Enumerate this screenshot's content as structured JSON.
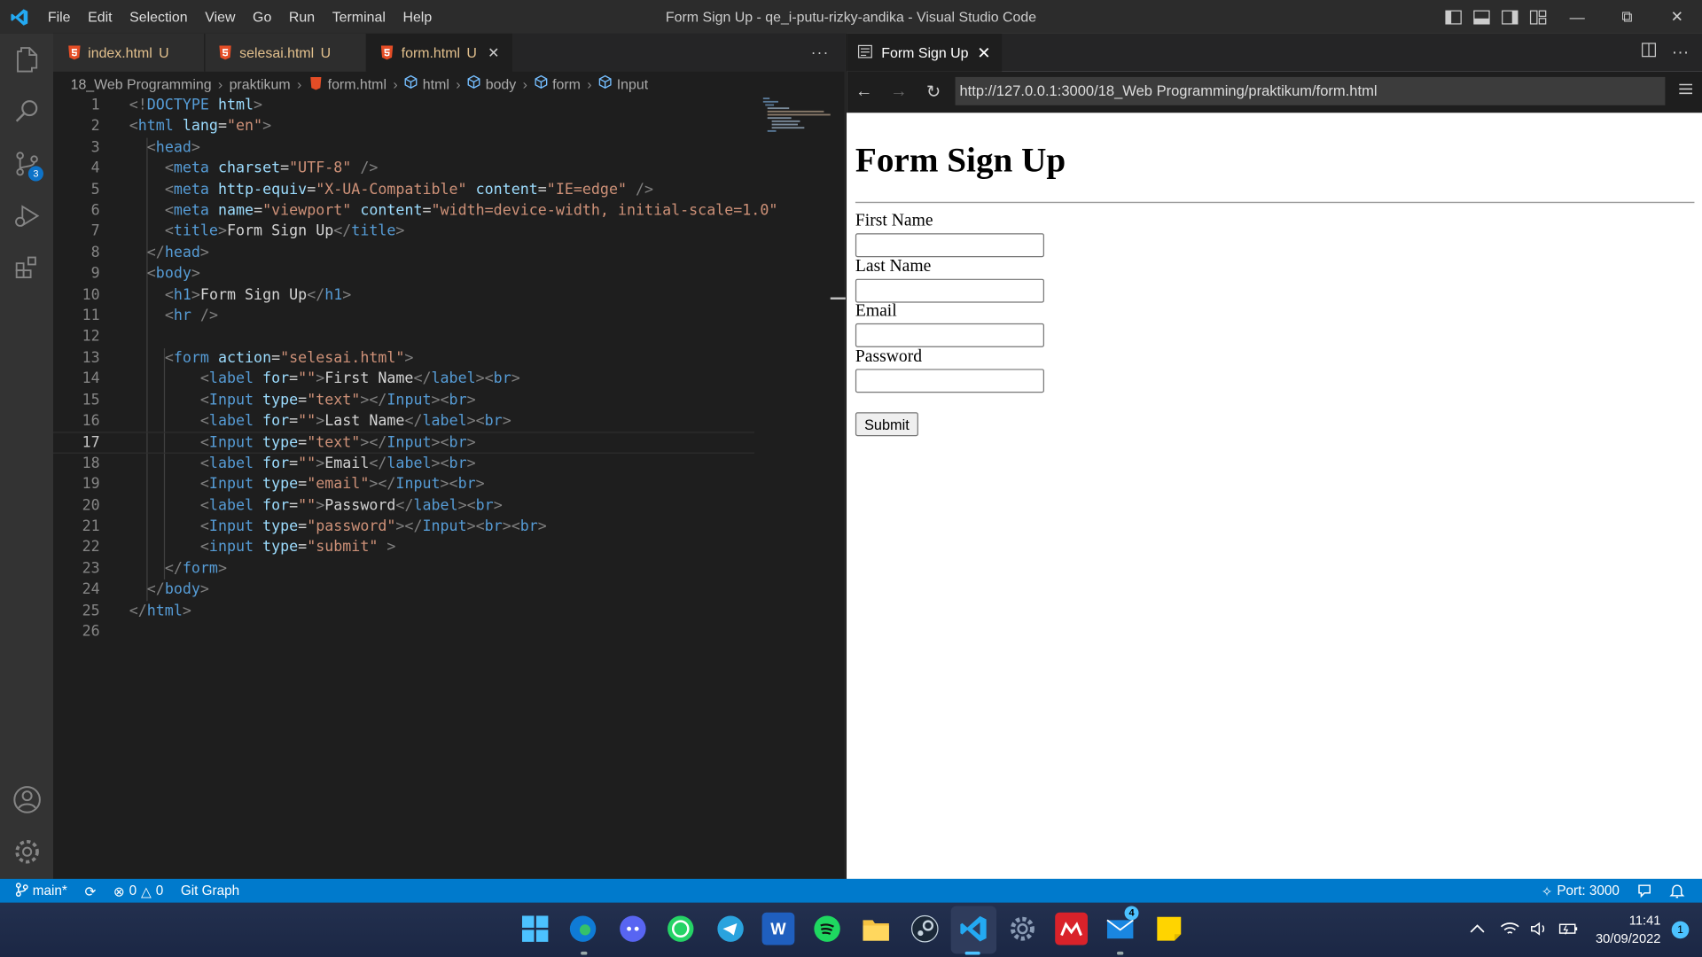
{
  "window": {
    "title": "Form Sign Up - qe_i-putu-rizky-andika - Visual Studio Code"
  },
  "menu": [
    "File",
    "Edit",
    "Selection",
    "View",
    "Go",
    "Run",
    "Terminal",
    "Help"
  ],
  "activity": {
    "source_control_badge": "3"
  },
  "editor": {
    "tabs": [
      {
        "name": "index.html",
        "status": "U"
      },
      {
        "name": "selesai.html",
        "status": "U"
      },
      {
        "name": "form.html",
        "status": "U",
        "active": true
      }
    ],
    "more": "···",
    "breadcrumb": [
      "18_Web Programming",
      "praktikum",
      "form.html",
      "html",
      "body",
      "form",
      "Input"
    ],
    "current_line": 17,
    "lines": [
      [
        {
          "c": "p",
          "v": "<!"
        },
        {
          "c": "t",
          "v": "DOCTYPE"
        },
        {
          "c": "x",
          "v": " "
        },
        {
          "c": "a",
          "v": "html"
        },
        {
          "c": "p",
          "v": ">"
        }
      ],
      [
        {
          "c": "p",
          "v": "<"
        },
        {
          "c": "t",
          "v": "html"
        },
        {
          "c": "x",
          "v": " "
        },
        {
          "c": "a",
          "v": "lang"
        },
        {
          "c": "x",
          "v": "="
        },
        {
          "c": "s",
          "v": "\"en\""
        },
        {
          "c": "p",
          "v": ">"
        }
      ],
      [
        {
          "c": "x",
          "v": "  "
        },
        {
          "c": "p",
          "v": "<"
        },
        {
          "c": "t",
          "v": "head"
        },
        {
          "c": "p",
          "v": ">"
        }
      ],
      [
        {
          "c": "x",
          "v": "    "
        },
        {
          "c": "p",
          "v": "<"
        },
        {
          "c": "t",
          "v": "meta"
        },
        {
          "c": "x",
          "v": " "
        },
        {
          "c": "a",
          "v": "charset"
        },
        {
          "c": "x",
          "v": "="
        },
        {
          "c": "s",
          "v": "\"UTF-8\""
        },
        {
          "c": "x",
          "v": " "
        },
        {
          "c": "p",
          "v": "/>"
        }
      ],
      [
        {
          "c": "x",
          "v": "    "
        },
        {
          "c": "p",
          "v": "<"
        },
        {
          "c": "t",
          "v": "meta"
        },
        {
          "c": "x",
          "v": " "
        },
        {
          "c": "a",
          "v": "http-equiv"
        },
        {
          "c": "x",
          "v": "="
        },
        {
          "c": "s",
          "v": "\"X-UA-Compatible\""
        },
        {
          "c": "x",
          "v": " "
        },
        {
          "c": "a",
          "v": "content"
        },
        {
          "c": "x",
          "v": "="
        },
        {
          "c": "s",
          "v": "\"IE=edge\""
        },
        {
          "c": "x",
          "v": " "
        },
        {
          "c": "p",
          "v": "/>"
        }
      ],
      [
        {
          "c": "x",
          "v": "    "
        },
        {
          "c": "p",
          "v": "<"
        },
        {
          "c": "t",
          "v": "meta"
        },
        {
          "c": "x",
          "v": " "
        },
        {
          "c": "a",
          "v": "name"
        },
        {
          "c": "x",
          "v": "="
        },
        {
          "c": "s",
          "v": "\"viewport\""
        },
        {
          "c": "x",
          "v": " "
        },
        {
          "c": "a",
          "v": "content"
        },
        {
          "c": "x",
          "v": "="
        },
        {
          "c": "s",
          "v": "\"width=device-width, initial-scale=1.0\""
        }
      ],
      [
        {
          "c": "x",
          "v": "    "
        },
        {
          "c": "p",
          "v": "<"
        },
        {
          "c": "t",
          "v": "title"
        },
        {
          "c": "p",
          "v": ">"
        },
        {
          "c": "x",
          "v": "Form Sign Up"
        },
        {
          "c": "p",
          "v": "</"
        },
        {
          "c": "t",
          "v": "title"
        },
        {
          "c": "p",
          "v": ">"
        }
      ],
      [
        {
          "c": "x",
          "v": "  "
        },
        {
          "c": "p",
          "v": "</"
        },
        {
          "c": "t",
          "v": "head"
        },
        {
          "c": "p",
          "v": ">"
        }
      ],
      [
        {
          "c": "x",
          "v": "  "
        },
        {
          "c": "p",
          "v": "<"
        },
        {
          "c": "t",
          "v": "body"
        },
        {
          "c": "p",
          "v": ">"
        }
      ],
      [
        {
          "c": "x",
          "v": "    "
        },
        {
          "c": "p",
          "v": "<"
        },
        {
          "c": "t",
          "v": "h1"
        },
        {
          "c": "p",
          "v": ">"
        },
        {
          "c": "x",
          "v": "Form Sign Up"
        },
        {
          "c": "p",
          "v": "</"
        },
        {
          "c": "t",
          "v": "h1"
        },
        {
          "c": "p",
          "v": ">"
        }
      ],
      [
        {
          "c": "x",
          "v": "    "
        },
        {
          "c": "p",
          "v": "<"
        },
        {
          "c": "t",
          "v": "hr"
        },
        {
          "c": "x",
          "v": " "
        },
        {
          "c": "p",
          "v": "/>"
        }
      ],
      [],
      [
        {
          "c": "x",
          "v": "    "
        },
        {
          "c": "p",
          "v": "<"
        },
        {
          "c": "t",
          "v": "form"
        },
        {
          "c": "x",
          "v": " "
        },
        {
          "c": "a",
          "v": "action"
        },
        {
          "c": "x",
          "v": "="
        },
        {
          "c": "s",
          "v": "\"selesai.html\""
        },
        {
          "c": "p",
          "v": ">"
        }
      ],
      [
        {
          "c": "x",
          "v": "        "
        },
        {
          "c": "p",
          "v": "<"
        },
        {
          "c": "t",
          "v": "label"
        },
        {
          "c": "x",
          "v": " "
        },
        {
          "c": "a",
          "v": "for"
        },
        {
          "c": "x",
          "v": "="
        },
        {
          "c": "s",
          "v": "\"\""
        },
        {
          "c": "p",
          "v": ">"
        },
        {
          "c": "x",
          "v": "First Name"
        },
        {
          "c": "p",
          "v": "</"
        },
        {
          "c": "t",
          "v": "label"
        },
        {
          "c": "p",
          "v": "><"
        },
        {
          "c": "t",
          "v": "br"
        },
        {
          "c": "p",
          "v": ">"
        }
      ],
      [
        {
          "c": "x",
          "v": "        "
        },
        {
          "c": "p",
          "v": "<"
        },
        {
          "c": "t",
          "v": "Input"
        },
        {
          "c": "x",
          "v": " "
        },
        {
          "c": "a",
          "v": "type"
        },
        {
          "c": "x",
          "v": "="
        },
        {
          "c": "s",
          "v": "\"text\""
        },
        {
          "c": "p",
          "v": "></"
        },
        {
          "c": "t",
          "v": "Input"
        },
        {
          "c": "p",
          "v": "><"
        },
        {
          "c": "t",
          "v": "br"
        },
        {
          "c": "p",
          "v": ">"
        }
      ],
      [
        {
          "c": "x",
          "v": "        "
        },
        {
          "c": "p",
          "v": "<"
        },
        {
          "c": "t",
          "v": "label"
        },
        {
          "c": "x",
          "v": " "
        },
        {
          "c": "a",
          "v": "for"
        },
        {
          "c": "x",
          "v": "="
        },
        {
          "c": "s",
          "v": "\"\""
        },
        {
          "c": "p",
          "v": ">"
        },
        {
          "c": "x",
          "v": "Last Name"
        },
        {
          "c": "p",
          "v": "</"
        },
        {
          "c": "t",
          "v": "label"
        },
        {
          "c": "p",
          "v": "><"
        },
        {
          "c": "t",
          "v": "br"
        },
        {
          "c": "p",
          "v": ">"
        }
      ],
      [
        {
          "c": "x",
          "v": "        "
        },
        {
          "c": "p",
          "v": "<"
        },
        {
          "c": "t",
          "v": "Input"
        },
        {
          "c": "x",
          "v": " "
        },
        {
          "c": "a",
          "v": "type"
        },
        {
          "c": "x",
          "v": "="
        },
        {
          "c": "s",
          "v": "\"text\""
        },
        {
          "c": "p",
          "v": "></"
        },
        {
          "c": "t",
          "v": "Input"
        },
        {
          "c": "p",
          "v": "><"
        },
        {
          "c": "t",
          "v": "br"
        },
        {
          "c": "p",
          "v": ">"
        }
      ],
      [
        {
          "c": "x",
          "v": "        "
        },
        {
          "c": "p",
          "v": "<"
        },
        {
          "c": "t",
          "v": "label"
        },
        {
          "c": "x",
          "v": " "
        },
        {
          "c": "a",
          "v": "for"
        },
        {
          "c": "x",
          "v": "="
        },
        {
          "c": "s",
          "v": "\"\""
        },
        {
          "c": "p",
          "v": ">"
        },
        {
          "c": "x",
          "v": "Email"
        },
        {
          "c": "p",
          "v": "</"
        },
        {
          "c": "t",
          "v": "label"
        },
        {
          "c": "p",
          "v": "><"
        },
        {
          "c": "t",
          "v": "br"
        },
        {
          "c": "p",
          "v": ">"
        }
      ],
      [
        {
          "c": "x",
          "v": "        "
        },
        {
          "c": "p",
          "v": "<"
        },
        {
          "c": "t",
          "v": "Input"
        },
        {
          "c": "x",
          "v": " "
        },
        {
          "c": "a",
          "v": "type"
        },
        {
          "c": "x",
          "v": "="
        },
        {
          "c": "s",
          "v": "\"email\""
        },
        {
          "c": "p",
          "v": "></"
        },
        {
          "c": "t",
          "v": "Input"
        },
        {
          "c": "p",
          "v": "><"
        },
        {
          "c": "t",
          "v": "br"
        },
        {
          "c": "p",
          "v": ">"
        }
      ],
      [
        {
          "c": "x",
          "v": "        "
        },
        {
          "c": "p",
          "v": "<"
        },
        {
          "c": "t",
          "v": "label"
        },
        {
          "c": "x",
          "v": " "
        },
        {
          "c": "a",
          "v": "for"
        },
        {
          "c": "x",
          "v": "="
        },
        {
          "c": "s",
          "v": "\"\""
        },
        {
          "c": "p",
          "v": ">"
        },
        {
          "c": "x",
          "v": "Password"
        },
        {
          "c": "p",
          "v": "</"
        },
        {
          "c": "t",
          "v": "label"
        },
        {
          "c": "p",
          "v": "><"
        },
        {
          "c": "t",
          "v": "br"
        },
        {
          "c": "p",
          "v": ">"
        }
      ],
      [
        {
          "c": "x",
          "v": "        "
        },
        {
          "c": "p",
          "v": "<"
        },
        {
          "c": "t",
          "v": "Input"
        },
        {
          "c": "x",
          "v": " "
        },
        {
          "c": "a",
          "v": "type"
        },
        {
          "c": "x",
          "v": "="
        },
        {
          "c": "s",
          "v": "\"password\""
        },
        {
          "c": "p",
          "v": "></"
        },
        {
          "c": "t",
          "v": "Input"
        },
        {
          "c": "p",
          "v": "><"
        },
        {
          "c": "t",
          "v": "br"
        },
        {
          "c": "p",
          "v": "><"
        },
        {
          "c": "t",
          "v": "br"
        },
        {
          "c": "p",
          "v": ">"
        }
      ],
      [
        {
          "c": "x",
          "v": "        "
        },
        {
          "c": "p",
          "v": "<"
        },
        {
          "c": "t",
          "v": "input"
        },
        {
          "c": "x",
          "v": " "
        },
        {
          "c": "a",
          "v": "type"
        },
        {
          "c": "x",
          "v": "="
        },
        {
          "c": "s",
          "v": "\"submit\""
        },
        {
          "c": "x",
          "v": " "
        },
        {
          "c": "p",
          "v": ">"
        }
      ],
      [
        {
          "c": "x",
          "v": "    "
        },
        {
          "c": "p",
          "v": "</"
        },
        {
          "c": "t",
          "v": "form"
        },
        {
          "c": "p",
          "v": ">"
        }
      ],
      [
        {
          "c": "x",
          "v": "  "
        },
        {
          "c": "p",
          "v": "</"
        },
        {
          "c": "t",
          "v": "body"
        },
        {
          "c": "p",
          "v": ">"
        }
      ],
      [
        {
          "c": "p",
          "v": "</"
        },
        {
          "c": "t",
          "v": "html"
        },
        {
          "c": "p",
          "v": ">"
        }
      ],
      []
    ]
  },
  "preview": {
    "tab_title": "Form Sign Up",
    "url": "http://127.0.0.1:3000/18_Web Programming/praktikum/form.html",
    "heading": "Form Sign Up",
    "fields": [
      {
        "label": "First Name",
        "type": "text",
        "value": ""
      },
      {
        "label": "Last Name",
        "type": "text",
        "value": ""
      },
      {
        "label": "Email",
        "type": "email",
        "value": ""
      },
      {
        "label": "Password",
        "type": "password",
        "value": ""
      }
    ],
    "submit_label": "Submit"
  },
  "status": {
    "branch": "main*",
    "errors": "0",
    "warnings": "0",
    "git_graph": "Git Graph",
    "port": "Port: 3000"
  },
  "taskbar": {
    "apps": [
      "start-icon",
      "edge-icon",
      "discord-icon",
      "whatsapp-icon",
      "telegram-icon",
      "word-icon",
      "spotify-icon",
      "file-explorer-icon",
      "steam-icon",
      "vscode-icon",
      "settings-icon",
      "mendeley-icon",
      "mail-icon",
      "sticky-notes-icon"
    ],
    "mail_badge": "4",
    "time": "11:41",
    "date": "30/09/2022",
    "notifications": "1"
  },
  "colors": {
    "statusbar": "#007acc",
    "accent": "#0e73c8",
    "modified": "#e2c08d"
  }
}
